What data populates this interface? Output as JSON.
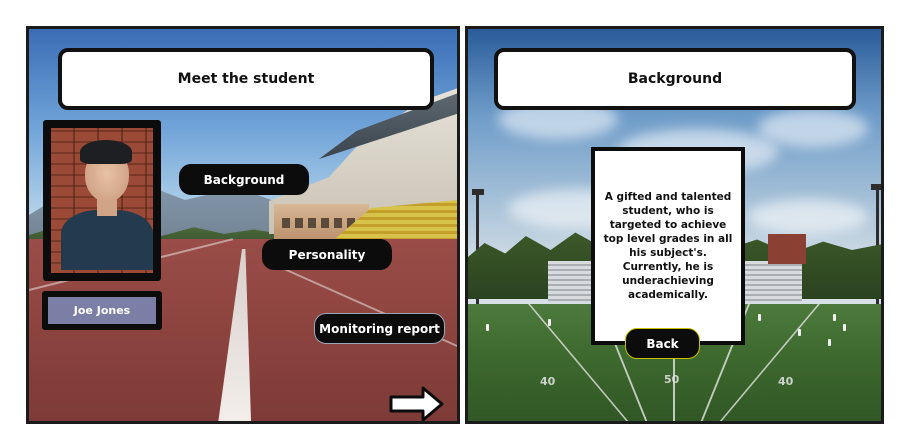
{
  "left_screen": {
    "title": "Meet the student",
    "student_name": "Joe Jones",
    "buttons": {
      "background": "Background",
      "personality": "Personality",
      "monitoring_report": "Monitoring report"
    },
    "next_icon": "right-arrow-icon"
  },
  "right_screen": {
    "title": "Background",
    "description": "A gifted and talented student, who is targeted to achieve top level grades in all his subject's. Currently, he is underachieving academically.",
    "back_button": "Back",
    "yard_numbers": [
      "40",
      "50",
      "40"
    ]
  },
  "colors": {
    "button_fill": "#0c0c0c",
    "name_plate_fill": "#7b7fa6",
    "title_box_fill": "#ffffff"
  }
}
